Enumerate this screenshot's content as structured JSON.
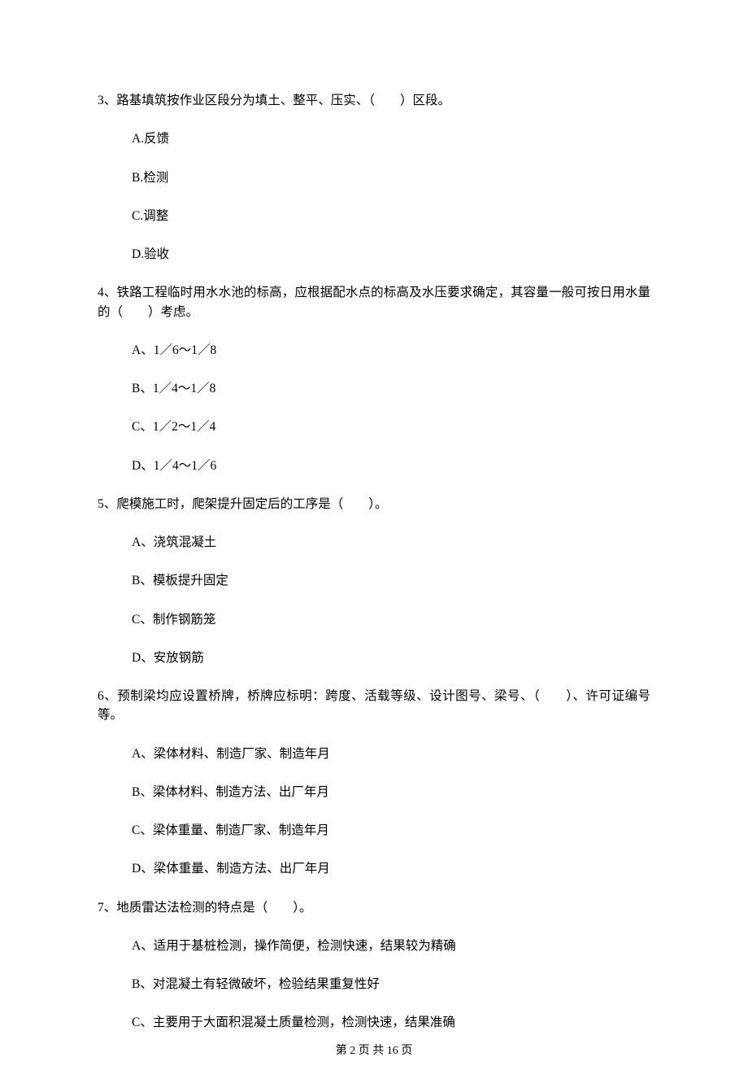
{
  "questions": [
    {
      "stem": "3、路基填筑按作业区段分为填土、整平、压实、（　　）区段。",
      "options": [
        "A.反馈",
        "B.检测",
        "C.调整",
        "D.验收"
      ]
    },
    {
      "stem": "4、铁路工程临时用水水池的标高，应根据配水点的标高及水压要求确定，其容量一般可按日用水量的（　　）考虑。",
      "options": [
        "A、1／6～1／8",
        "B、1／4～1／8",
        "C、1／2～1／4",
        "D、1／4～1／6"
      ]
    },
    {
      "stem": "5、爬模施工时，爬架提升固定后的工序是（　　）。",
      "options": [
        "A、浇筑混凝土",
        "B、模板提升固定",
        "C、制作钢筋笼",
        "D、安放钢筋"
      ]
    },
    {
      "stem": "6、预制梁均应设置桥牌，桥牌应标明：跨度、活载等级、设计图号、梁号、（　　）、许可证编号等。",
      "options": [
        "A、梁体材料、制造厂家、制造年月",
        "B、梁体材料、制造方法、出厂年月",
        "C、梁体重量、制造厂家、制造年月",
        "D、梁体重量、制造方法、出厂年月"
      ]
    },
    {
      "stem": "7、地质雷达法检测的特点是（　　）。",
      "options": [
        "A、适用于基桩检测，操作简便，检测快速，结果较为精确",
        "B、对混凝土有轻微破坏，检验结果重复性好",
        "C、主要用于大面积混凝土质量检测，检测快速，结果准确"
      ]
    }
  ],
  "footer": "第 2 页 共 16 页"
}
